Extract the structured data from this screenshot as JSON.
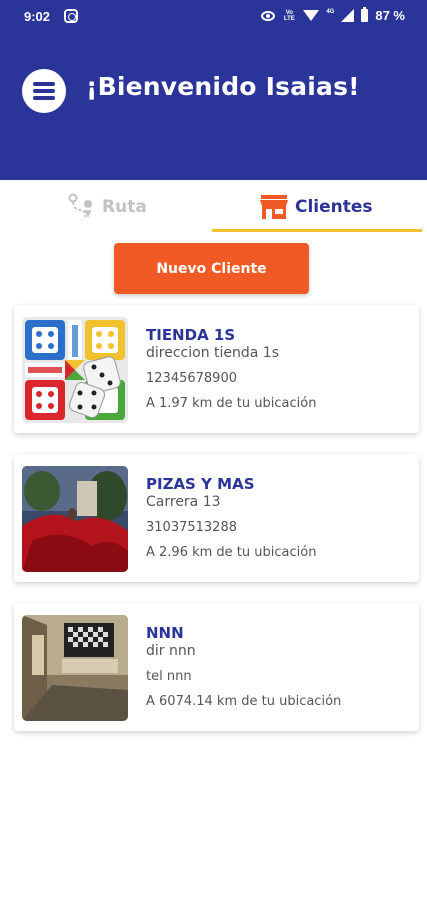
{
  "status_bar": {
    "time": "9:02",
    "network": "Vo LTE",
    "network_4g": "4G",
    "battery": "87 %"
  },
  "header": {
    "greeting": "¡Bienvenido Isaias!"
  },
  "tabs": [
    {
      "label": "Ruta",
      "icon": "route-icon",
      "active": false
    },
    {
      "label": "Clientes",
      "icon": "store-icon",
      "active": true
    }
  ],
  "actions": {
    "new_client_label": "Nuevo Cliente"
  },
  "clients": [
    {
      "name": "TIENDA 1S",
      "address": "direccion tienda 1s",
      "phone": "12345678900",
      "distance": "A 1.97 km de tu ubicación",
      "image": "ludo-board-thumbnail"
    },
    {
      "name": "PIZAS Y MAS",
      "address": "Carrera 13",
      "phone": "31037513288",
      "distance": "A 2.96 km de tu ubicación",
      "image": "red-dress-photo-thumbnail"
    },
    {
      "name": "NNN",
      "address": "dir nnn",
      "phone": "tel nnn",
      "distance": "A 6074.14 km de tu ubicación",
      "image": "room-interior-thumbnail"
    }
  ],
  "colors": {
    "primary": "#2a3499",
    "accent": "#f15a24",
    "tab_indicator": "#f2c12e",
    "inactive": "#c2c2c2"
  }
}
